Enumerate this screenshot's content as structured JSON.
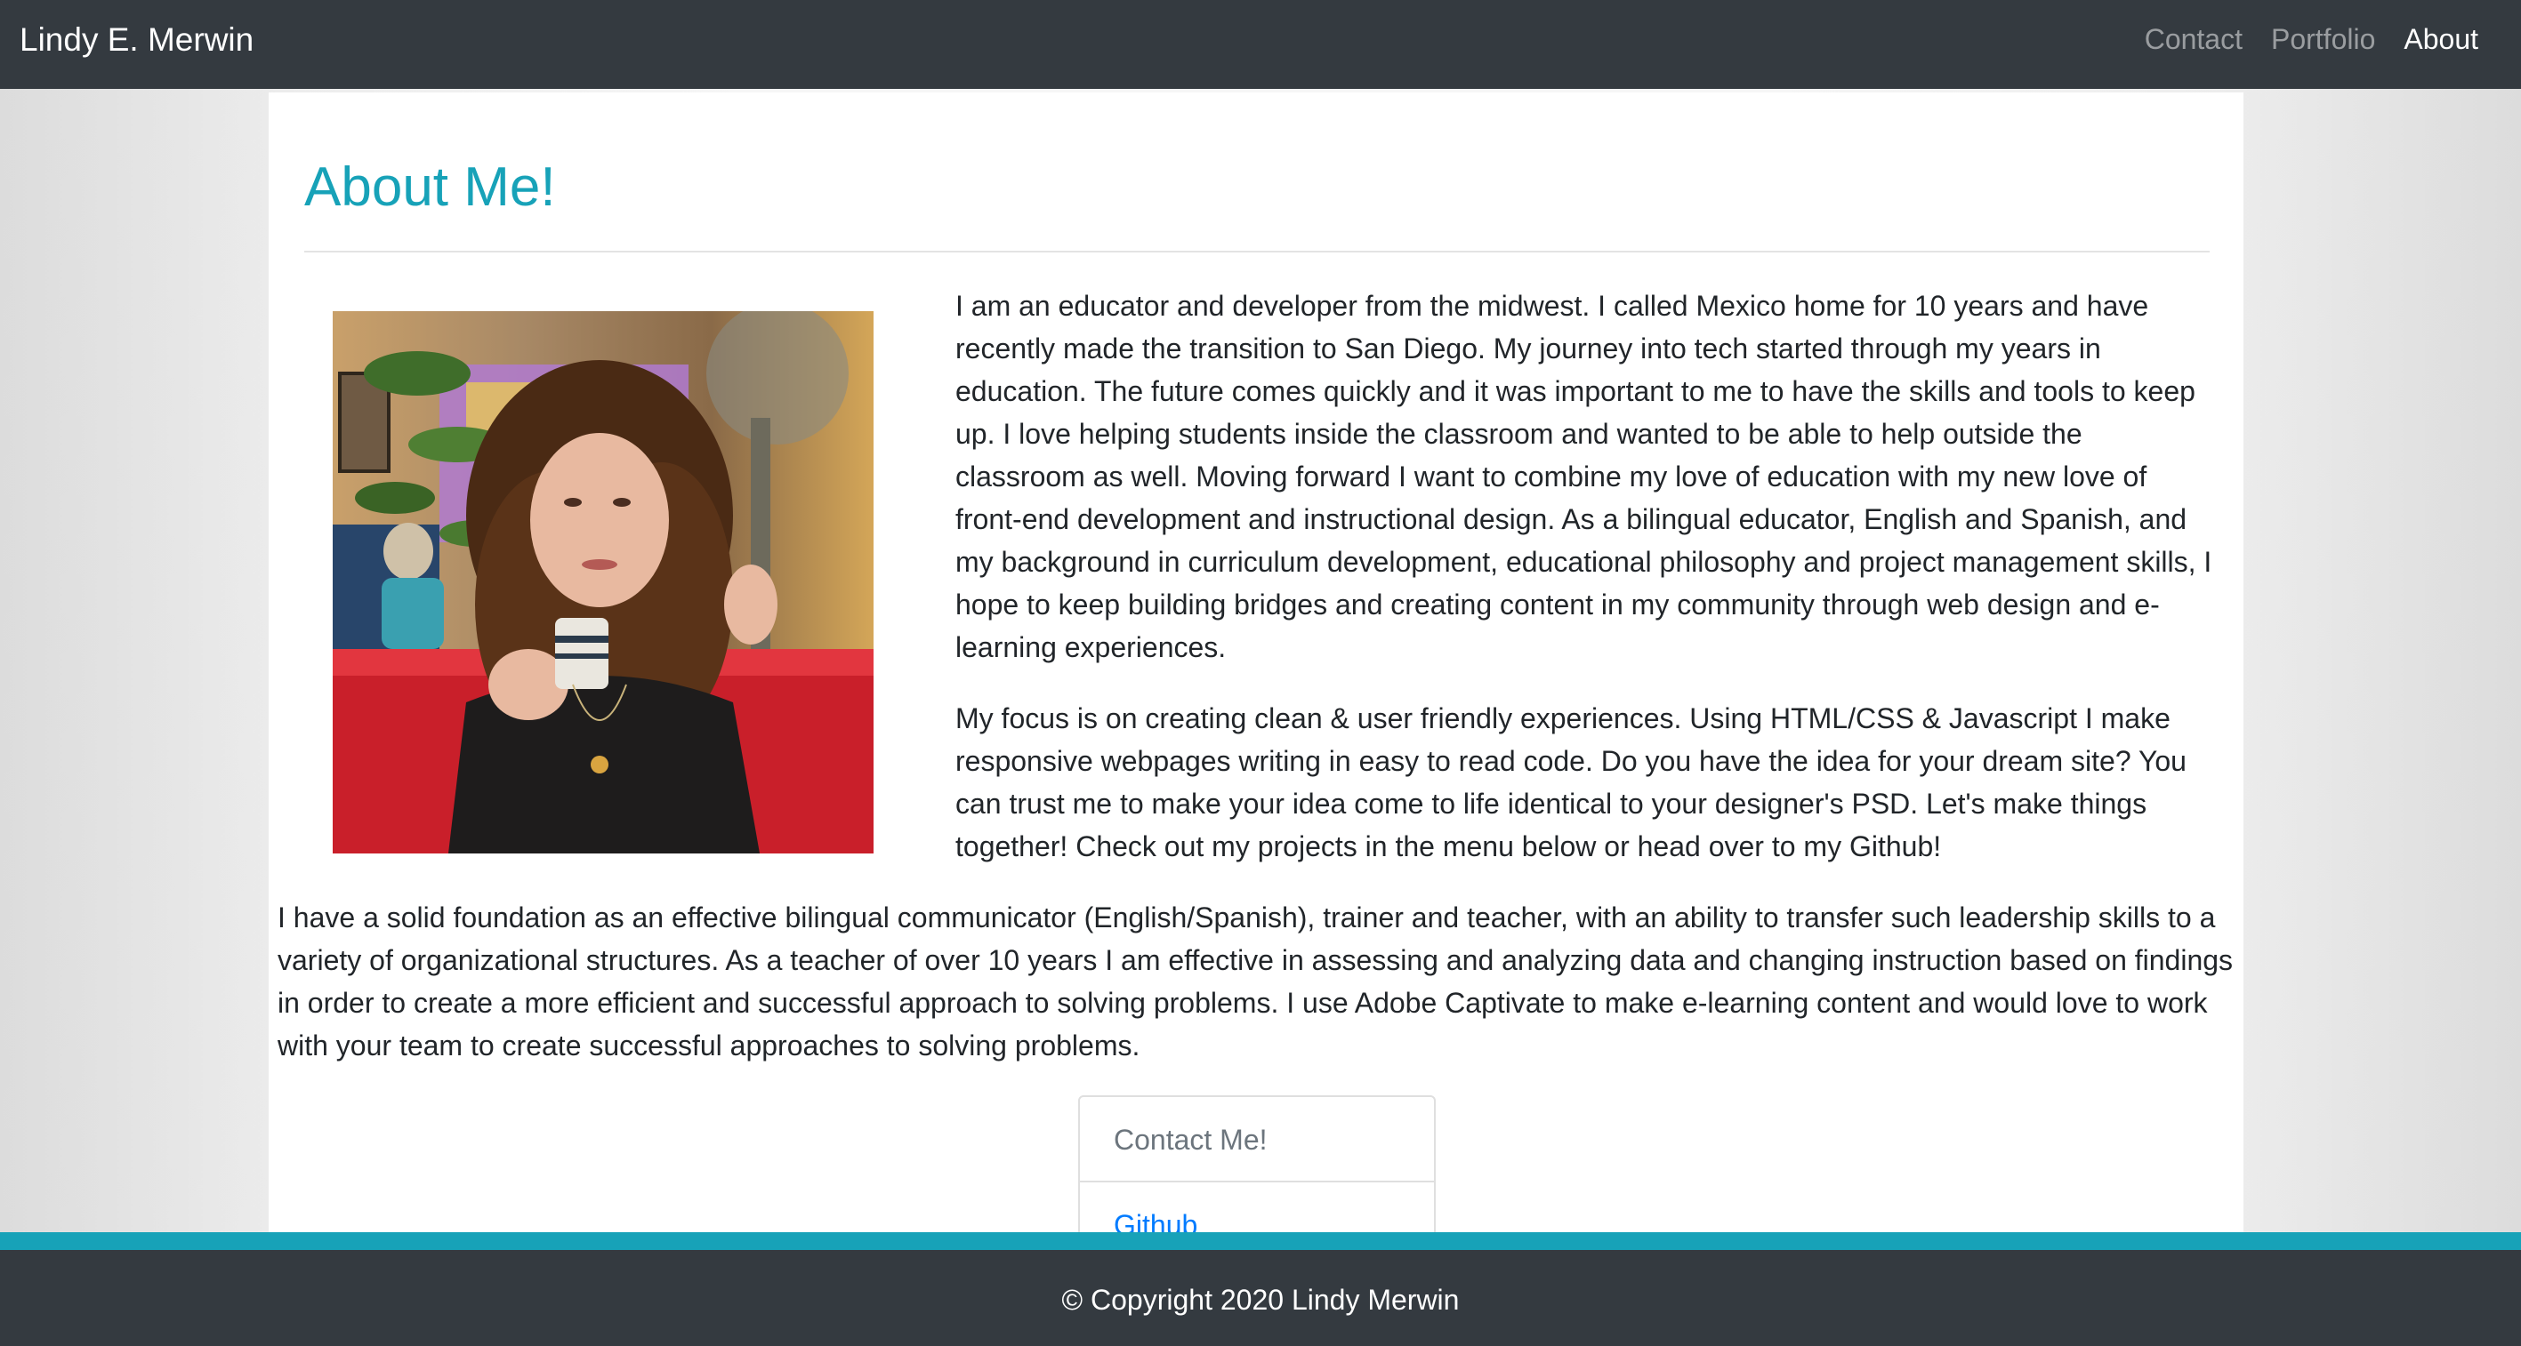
{
  "navbar": {
    "brand": "Lindy E. Merwin",
    "links": [
      {
        "label": "Contact"
      },
      {
        "label": "Portfolio"
      },
      {
        "label": "About"
      }
    ],
    "active": "About"
  },
  "main": {
    "title": "About Me!",
    "paragraphs": [
      "I am an educator and developer from the midwest. I called Mexico home for 10 years and have recently made the transition to San Diego. My journey into tech started through my years in education. The future comes quickly and it was important to me to have the skills and tools to keep up. I love helping students inside the classroom and wanted to be able to help outside the classroom as well. Moving forward I want to combine my love of education with my new love of front-end development and instructional design. As a bilingual educator, English and Spanish, and my background in curriculum development, educational philosophy and project management skills, I hope to keep building bridges and creating content in my community through web design and e-learning experiences.",
      "My focus is on creating clean & user friendly experiences. Using HTML/CSS & Javascript I make responsive webpages writing in easy to read code. Do you have the idea for your dream site? You can trust me to make your idea come to life identical to your designer's PSD. Let's make things together! Check out my projects in the menu below or head over to my Github!",
      "I have a solid foundation as an effective bilingual communicator (English/Spanish), trainer and teacher, with an ability to transfer such leadership skills to a variety of organizational structures. As a teacher of over 10 years I am effective in assessing and analyzing data and changing instruction based on findings in order to create a more efficient and successful approach to solving problems. I use Adobe Captivate to make e-learning content and would love to work with your team to create successful approaches to solving problems."
    ],
    "contact_list": {
      "header": "Contact Me!",
      "items": [
        {
          "label": "Github"
        }
      ]
    }
  },
  "footer": {
    "copyright": "© Copyright 2020 Lindy Merwin"
  },
  "colors": {
    "navbar_bg": "#343a40",
    "accent": "#17a2b8",
    "link": "#007bff",
    "nav_inactive": "rgba(255,255,255,0.5)"
  }
}
